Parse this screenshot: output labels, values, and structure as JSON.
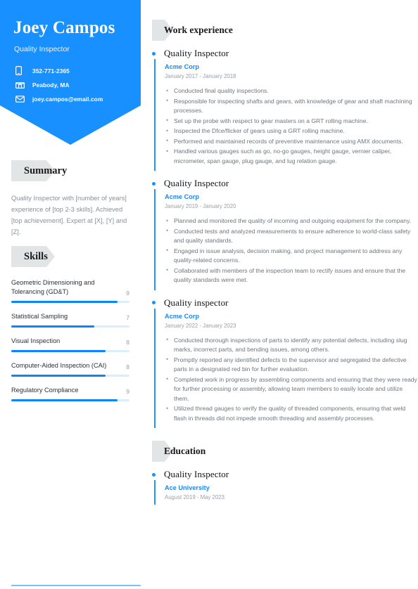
{
  "theme": {
    "accent": "#1890ff",
    "accent_dark": "#0a84ff",
    "track": "#dbeeff",
    "tag_gray": "#e2e5e6"
  },
  "header": {
    "name": "Joey Campos",
    "role": "Quality Inspector",
    "contacts": [
      {
        "icon": "phone-icon",
        "text": "352-771-2365"
      },
      {
        "icon": "location-icon",
        "text": "Peabody, MA"
      },
      {
        "icon": "email-icon",
        "text": "joey.campos@email.com"
      }
    ]
  },
  "summary": {
    "title": "Summary",
    "text": "Quality Inspector with [number of years] experience of [top 2-3 skills]. Achieved [top achievement]. Expert at [X], [Y] and [Z]."
  },
  "skills": {
    "title": "Skills",
    "items": [
      {
        "name": "Geometric Dimensioning and Tolerancing (GD&T)",
        "score": "9",
        "pct": 90
      },
      {
        "name": "Statistical Sampling",
        "score": "7",
        "pct": 70
      },
      {
        "name": "Visual Inspection",
        "score": "8",
        "pct": 80
      },
      {
        "name": "Computer-Aided Inspection (CAI)",
        "score": "8",
        "pct": 80
      },
      {
        "name": "Regulatory Compliance",
        "score": "9",
        "pct": 90
      }
    ]
  },
  "work": {
    "title": "Work experience",
    "entries": [
      {
        "title": "Quality Inspector",
        "org": "Acme Corp",
        "dates": "January 2017 - January 2018",
        "bullets": [
          "Conducted final quality inspections.",
          "Responsible for inspecting shafts and gears, with knowledge of gear and shaft machining processes.",
          "Set up the probe with respect to gear masters on a GRT rolling machine.",
          "Inspected the Dfce/flicker of gears using a GRT rolling machine.",
          "Performed and maintained records of preventive maintenance using AMX documents.",
          "Handled various gauges such as go, no-go gauges, height gauge, vernier caliper, micrometer, span gauge, plug gauge, and lug relation gauge."
        ]
      },
      {
        "title": "Quality Inspector",
        "org": "Acme Corp",
        "dates": "January 2019 - January 2020",
        "bullets": [
          "Planned and monitored the quality of incoming and outgoing equipment for the company.",
          "Conducted tests and analyzed measurements to ensure adherence to world-class safety and quality standards.",
          "Engaged in issue analysis, decision making, and project management to address any quality-related concerns.",
          "Collaborated with members of the inspection team to rectify issues and ensure that the quality standards were met."
        ]
      },
      {
        "title": "Quality inspector",
        "org": "Acme Corp",
        "dates": "January 2022 - January 2023",
        "bullets": [
          "Conducted thorough inspections of parts to identify any potential defects, including slug marks, incorrect parts, and bending issues, among others.",
          "Promptly reported any identified defects to the supervisor and segregated the defective parts in a designated red bin for further evaluation.",
          "Completed work in progress by assembling components and ensuring that they were ready for further processing or assembly, allowing team members to easily locate and utilize them.",
          "Utilized thread gauges to verify the quality of threaded components, ensuring that weld flash in threads did not impede smooth threading and assembly processes."
        ]
      }
    ]
  },
  "education": {
    "title": "Education",
    "entries": [
      {
        "title": "Quality Inspector",
        "org": "Ace University",
        "dates": "August 2019 - May 2023",
        "bullets": []
      }
    ]
  }
}
